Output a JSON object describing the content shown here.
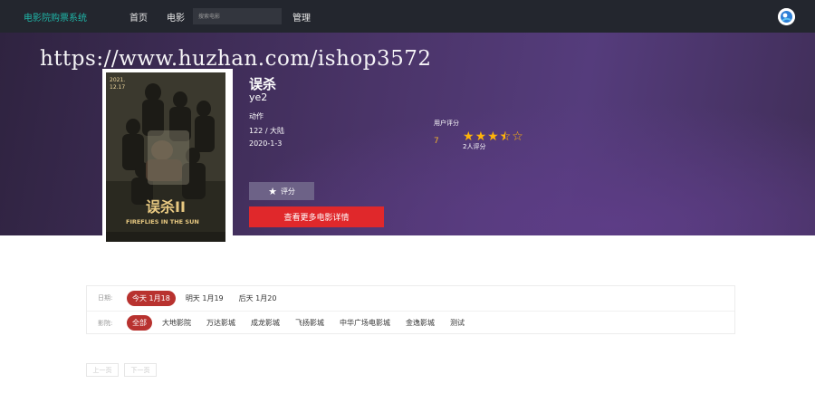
{
  "navbar": {
    "brand": "电影院购票系统",
    "items": [
      "首页",
      "电影"
    ],
    "search_placeholder": "搜索电影",
    "admin": "管理",
    "avatar_icon": "user-avatar-icon"
  },
  "watermark": "https://www.huzhan.com/ishop3572",
  "movie": {
    "title": "误杀",
    "english_title": "ye2",
    "genre": "动作",
    "duration_region": "122 / 大陆",
    "release_date": "2020-1-3",
    "poster": {
      "date_text": "2021.\n12.17",
      "title_text": "误杀II",
      "subtitle_text": "FIREFLIES IN THE SUN"
    }
  },
  "rating": {
    "label": "用户评分",
    "value": "7",
    "stars_full": 3,
    "stars_half": 1,
    "stars_total": 5,
    "count": "2人评分"
  },
  "buttons": {
    "rate_label": "评分",
    "detail_label": "查看更多电影详情"
  },
  "filters": {
    "date_label": "日期:",
    "dates": [
      "今天 1月18",
      "明天 1月19",
      "后天 1月20"
    ],
    "cinema_label": "影院:",
    "cinemas": [
      "全部",
      "大地影院",
      "万达影城",
      "成龙影城",
      "飞扬影城",
      "中华广场电影城",
      "金逸影城",
      "测试"
    ]
  },
  "pagination": {
    "prev": "上一页",
    "next": "下一页"
  },
  "colors": {
    "accent_red": "#e0282b",
    "active_chip": "#b8322f",
    "brand": "#1fb6a8",
    "star": "#ffb40a"
  }
}
